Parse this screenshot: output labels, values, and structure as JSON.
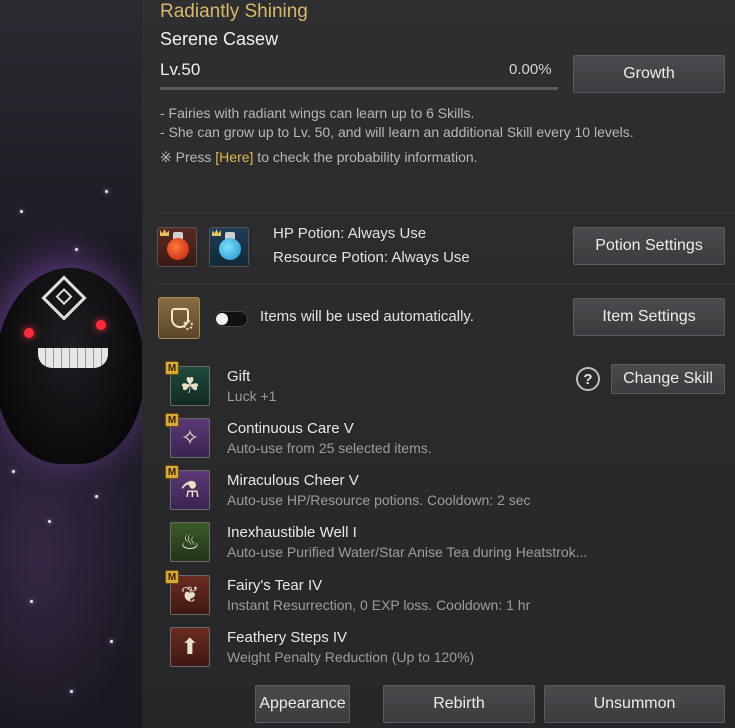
{
  "pet": {
    "title": "Radiantly Shining",
    "name": "Serene Casew",
    "level": "Lv.50",
    "exp_percent": "0.00%",
    "exp_fraction": 0.0,
    "growth_button": "Growth"
  },
  "info": {
    "line1": "- Fairies with radiant wings can learn up to 6 Skills.",
    "line2": "- She can grow up to Lv. 50, and will learn an additional Skill every 10 levels.",
    "line3_prefix": "※ Press ",
    "line3_link": "[Here]",
    "line3_suffix": " to check the probability information."
  },
  "potions": {
    "hp_label": "HP Potion: Always Use",
    "resource_label": "Resource Potion: Always Use",
    "settings_button": "Potion Settings",
    "hp_icon": "hp-potion-icon",
    "resource_icon": "resource-potion-icon"
  },
  "items": {
    "auto_label": "Items will be used automatically.",
    "toggle_on": false,
    "settings_button": "Item Settings",
    "icon": "auto-use-flask-icon"
  },
  "skills_header": {
    "help_label": "?",
    "change_button": "Change Skill"
  },
  "skills": [
    {
      "name": "Gift",
      "desc": "Luck +1",
      "badge": "M",
      "icon": "clover-icon"
    },
    {
      "name": "Continuous Care V",
      "desc": "Auto-use from 25 selected items.",
      "badge": "M",
      "icon": "fairy-icon"
    },
    {
      "name": "Miraculous Cheer V",
      "desc": "Auto-use HP/Resource potions. Cooldown: 2 sec",
      "badge": "M",
      "icon": "potion-pair-icon"
    },
    {
      "name": "Inexhaustible Well I",
      "desc": "Auto-use Purified Water/Star Anise Tea during Heatstrok...",
      "badge": "",
      "icon": "tea-bowl-icon"
    },
    {
      "name": "Fairy's Tear IV",
      "desc": "Instant Resurrection, 0 EXP loss. Cooldown: 1 hr",
      "badge": "M",
      "icon": "tear-icon"
    },
    {
      "name": "Feathery Steps IV",
      "desc": "Weight Penalty Reduction (Up to 120%)",
      "badge": "",
      "icon": "weight-icon"
    }
  ],
  "footer": {
    "appearance": "Appearance",
    "rebirth": "Rebirth",
    "unsummon": "Unsummon"
  },
  "colors": {
    "gold_title": "#d8b86a",
    "highlight": "#e0b84c",
    "panel_bg": "#2f2f31",
    "button_bg": "#444447",
    "badge": "#d6a93b"
  }
}
